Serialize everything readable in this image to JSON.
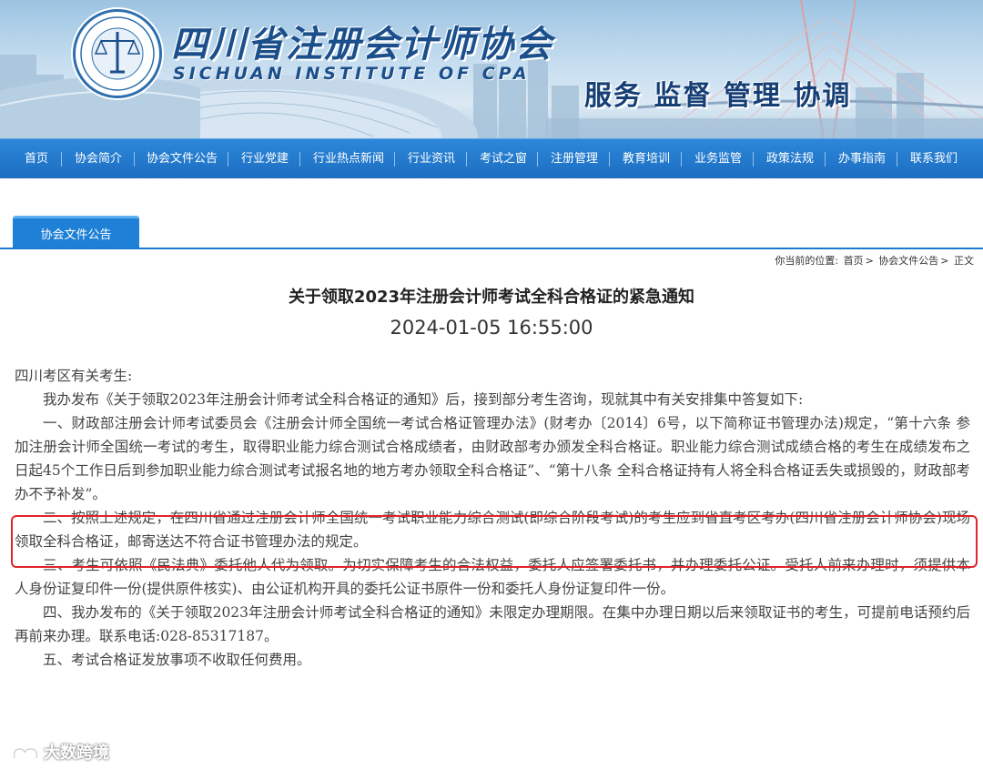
{
  "header": {
    "org_name_cn": "四川省注册会计师协会",
    "org_name_en": "SICHUAN INSTITUTE OF CPA",
    "slogan": "服务 监督 管理 协调",
    "seal_text": "SICHUAN INSTITUTE OF CERTIFIED PUBLIC ACCOUNTANTS"
  },
  "nav": {
    "items": [
      "首页",
      "协会简介",
      "协会文件公告",
      "行业党建",
      "行业热点新闻",
      "行业资讯",
      "考试之窗",
      "注册管理",
      "教育培训",
      "业务监管",
      "政策法规",
      "办事指南",
      "联系我们"
    ]
  },
  "section_tab": "协会文件公告",
  "breadcrumb": {
    "prefix": "你当前的位置:",
    "items": [
      "首页",
      "协会文件公告",
      "正文"
    ],
    "separator": ">"
  },
  "article": {
    "title": "关于领取2023年注册会计师考试全科合格证的紧急通知",
    "datetime": "2024-01-05 16:55:00",
    "salutation": "四川考区有关考生:",
    "paragraphs": [
      "我办发布《关于领取2023年注册会计师考试全科合格证的通知》后，接到部分考生咨询，现就其中有关安排集中答复如下:",
      "一、财政部注册会计师考试委员会《注册会计师全国统一考试合格证管理办法》(财考办〔2014〕6号，以下简称证书管理办法)规定，“第十六条 参加注册会计师全国统一考试的考生，取得职业能力综合测试合格成绩者，由财政部考办颁发全科合格证。职业能力综合测试成绩合格的考生在成绩发布之日起45个工作日后到参加职业能力综合测试考试报名地的地方考办领取全科合格证”、“第十八条 全科合格证持有人将全科合格证丢失或损毁的，财政部考办不予补发”。",
      "二、按照上述规定，在四川省通过注册会计师全国统一考试职业能力综合测试(即综合阶段考试)的考生应到省直考区考办(四川省注册会计师协会)现场领取全科合格证，邮寄送达不符合证书管理办法的规定。",
      "三、考生可依照《民法典》委托他人代为领取。为切实保障考生的合法权益，委托人应签署委托书，并办理委托公证。受托人前来办理时，须提供本人身份证复印件一份(提供原件核实)、由公证机构开具的委托公证书原件一份和委托人身份证复印件一份。",
      "四、我办发布的《关于领取2023年注册会计师考试全科合格证的通知》未限定办理期限。在集中办理日期以后来领取证书的考生，可提前电话预约后再前来办理。联系电话:028-85317187。",
      "五、考试合格证发放事项不收取任何费用。"
    ]
  },
  "watermark": "大数跨境",
  "colors": {
    "nav_bg": "#1c6ec3",
    "highlight_border": "#e0242b",
    "brand_blue": "#1b4f8c"
  }
}
